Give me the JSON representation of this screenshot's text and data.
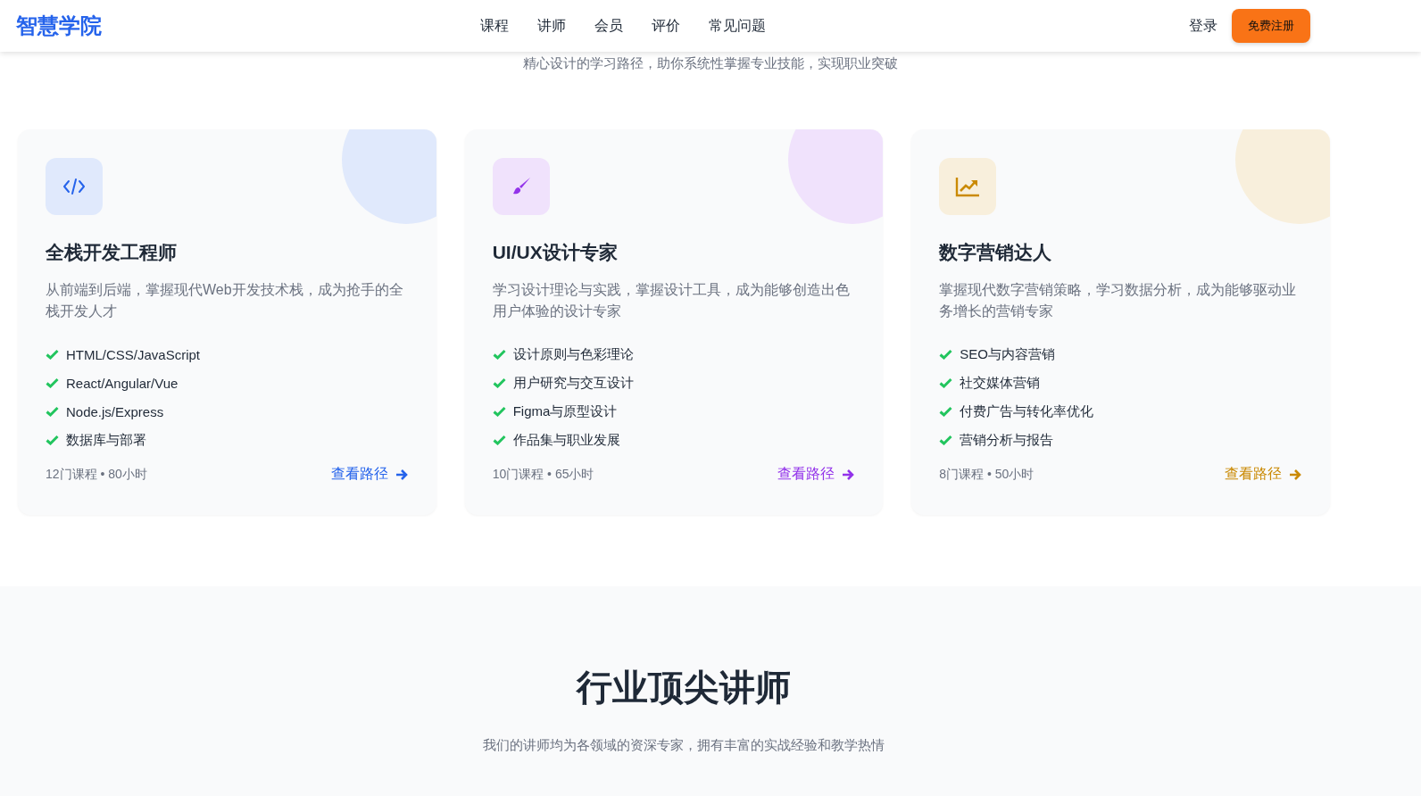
{
  "header": {
    "logo": "智慧学院",
    "nav": [
      {
        "label": "课程"
      },
      {
        "label": "讲师"
      },
      {
        "label": "会员"
      },
      {
        "label": "评价"
      },
      {
        "label": "常见问题"
      }
    ],
    "login": "登录",
    "signup": "免费注册"
  },
  "paths_section": {
    "subtitle": "精心设计的学习路径，助你系统性掌握专业技能，实现职业突破"
  },
  "paths": [
    {
      "kind": "code",
      "color": "#2563eb",
      "title": "全栈开发工程师",
      "description": "从前端到后端，掌握现代Web开发技术栈，成为抢手的全栈开发人才",
      "features": [
        "HTML/CSS/JavaScript",
        "React/Angular/Vue",
        "Node.js/Express",
        "数据库与部署"
      ],
      "meta": "12门课程 • 80小时",
      "link": "查看路径"
    },
    {
      "kind": "brush",
      "color": "#9333ea",
      "title": "UI/UX设计专家",
      "description": "学习设计理论与实践，掌握设计工具，成为能够创造出色用户体验的设计专家",
      "features": [
        "设计原则与色彩理论",
        "用户研究与交互设计",
        "Figma与原型设计",
        "作品集与职业发展"
      ],
      "meta": "10门课程 • 65小时",
      "link": "查看路径"
    },
    {
      "kind": "chart",
      "color": "#ca8a04",
      "title": "数字营销达人",
      "description": "掌握现代数字营销策略，学习数据分析，成为能够驱动业务增长的营销专家",
      "features": [
        "SEO与内容营销",
        "社交媒体营销",
        "付费广告与转化率优化",
        "营销分析与报告"
      ],
      "meta": "8门课程 • 50小时",
      "link": "查看路径"
    }
  ],
  "instructors_section": {
    "title": "行业顶尖讲师",
    "subtitle": "我们的讲师均为各领域的资深专家，拥有丰富的实战经验和教学热情"
  }
}
